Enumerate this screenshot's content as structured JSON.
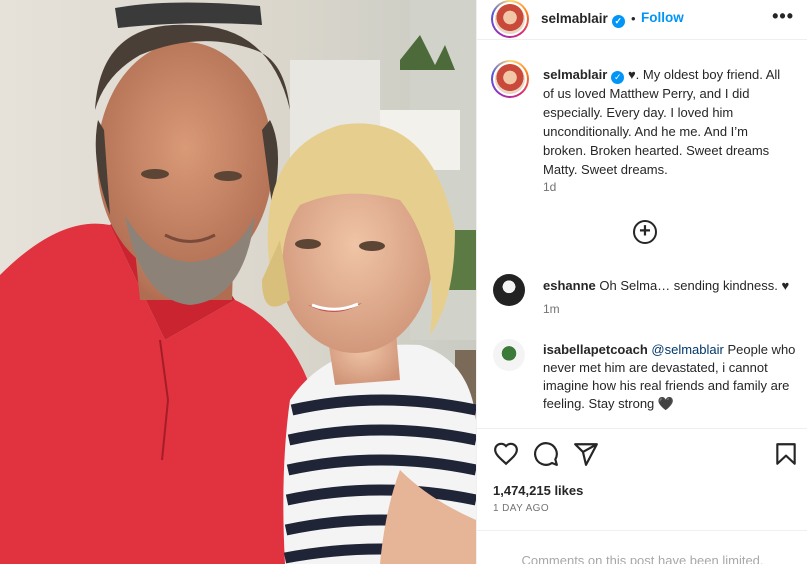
{
  "post": {
    "username": "selmablair",
    "separator": "•",
    "follow_label": "Follow",
    "more_label": "•••",
    "caption_text": "♥. My oldest boy friend. All of us loved Matthew Perry, and I did especially. Every day. I loved him unconditionally. And he me. And I’m broken. Broken hearted. Sweet dreams Matty. Sweet dreams.",
    "caption_time": "1d",
    "likes": "1,474,215 likes",
    "date": "1 DAY AGO",
    "comments_limited": "Comments on this post have been limited."
  },
  "comments": [
    {
      "username": "eshanne",
      "text": "Oh Selma… sending kindness. ♥",
      "time": "1m"
    },
    {
      "username": "isabellapetcoach",
      "mention": "@selmablair",
      "text": " People who never met him are devastated, i cannot imagine how his real friends and family are feeling. Stay strong 🖤"
    }
  ],
  "icons": {
    "verified": "verified-badge-icon",
    "add": "plus-circle-icon",
    "like": "heart-icon",
    "comment": "comment-icon",
    "share": "paper-plane-icon",
    "save": "bookmark-icon",
    "more": "more-options-icon"
  },
  "colors": {
    "follow": "#0095f6",
    "verified": "#0095f6",
    "muted": "#737373",
    "mention": "#00376b"
  }
}
